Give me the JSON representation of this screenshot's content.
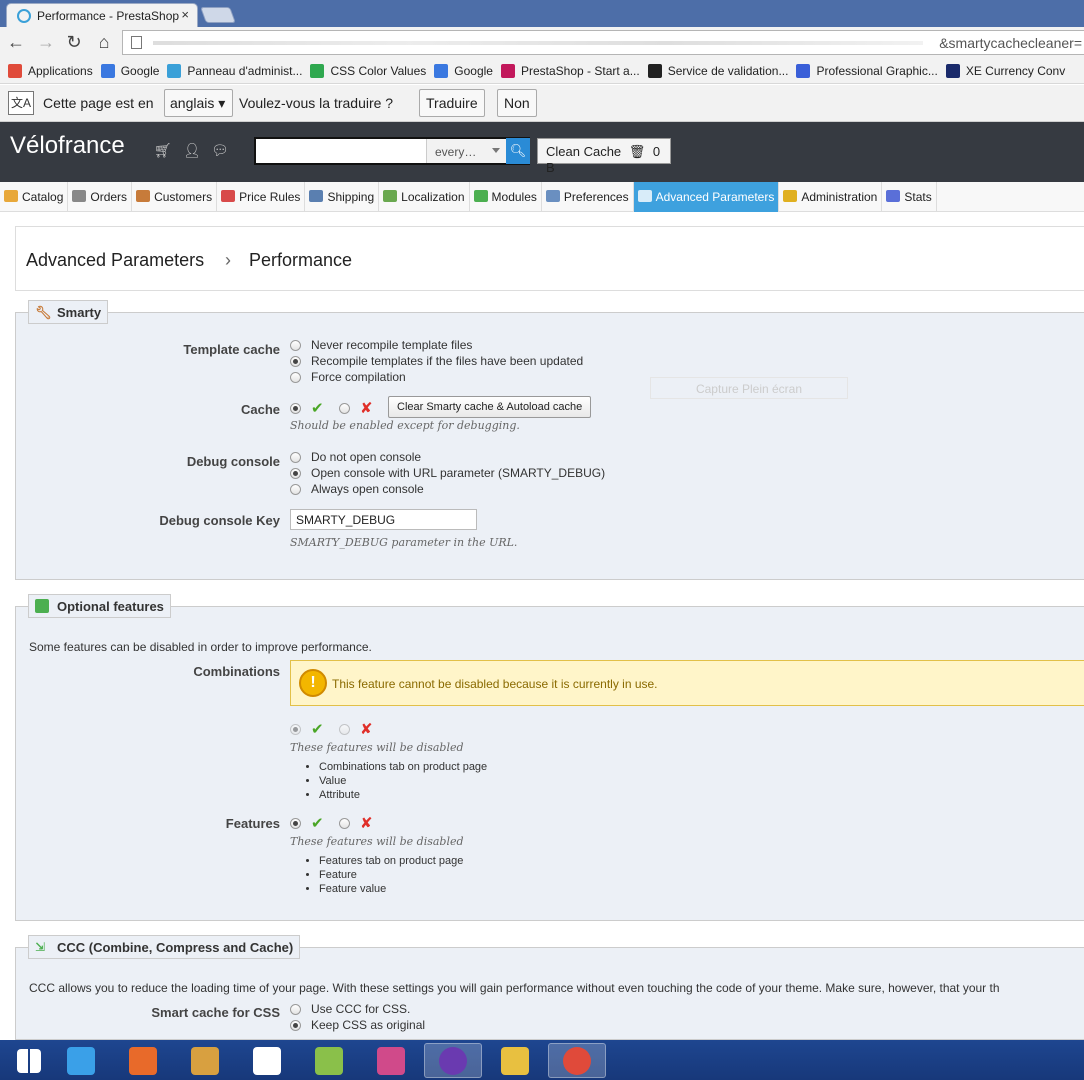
{
  "browser": {
    "tab_title": "Performance - PrestaShop",
    "tab_close": "×",
    "url_fragment": "&smartycachecleaner=",
    "bookmarks": [
      {
        "label": "Applications",
        "color": "#e04b3a"
      },
      {
        "label": "Google",
        "color": "#3a78e0"
      },
      {
        "label": "Panneau d'administ...",
        "color": "#3aa0d8"
      },
      {
        "label": "CSS Color Values",
        "color": "#2fa84f"
      },
      {
        "label": "Google",
        "color": "#3a78e0"
      },
      {
        "label": "PrestaShop - Start a...",
        "color": "#c2185b"
      },
      {
        "label": "Service de validation...",
        "color": "#222222"
      },
      {
        "label": "Professional Graphic...",
        "color": "#3a5fd8"
      },
      {
        "label": "XE Currency Conv",
        "color": "#1a2a6b"
      }
    ],
    "translate": {
      "prefix": "Cette page est en",
      "language": "anglais",
      "question": "Voulez-vous la traduire ?",
      "translate_btn": "Traduire",
      "no_btn": "Non"
    }
  },
  "header": {
    "shop_name": "Vélofrance",
    "search_placeholder": "",
    "search_scope": "every…",
    "clean_cache_label": "Clean Cache",
    "cache_size": "0 B"
  },
  "menu": [
    {
      "label": "Catalog",
      "color": "#e8a83a",
      "active": false
    },
    {
      "label": "Orders",
      "color": "#888888",
      "active": false
    },
    {
      "label": "Customers",
      "color": "#c77b3a",
      "active": false
    },
    {
      "label": "Price Rules",
      "color": "#d84a4a",
      "active": false
    },
    {
      "label": "Shipping",
      "color": "#5a7fb0",
      "active": false
    },
    {
      "label": "Localization",
      "color": "#6aa84f",
      "active": false
    },
    {
      "label": "Modules",
      "color": "#4caf50",
      "active": false
    },
    {
      "label": "Preferences",
      "color": "#6a8fc0",
      "active": false
    },
    {
      "label": "Advanced Parameters",
      "color": "#ffffff",
      "active": true
    },
    {
      "label": "Administration",
      "color": "#e0b020",
      "active": false
    },
    {
      "label": "Stats",
      "color": "#5a6fd8",
      "active": false
    }
  ],
  "breadcrumb": {
    "parent": "Advanced Parameters",
    "separator": "›",
    "current": "Performance"
  },
  "smarty": {
    "legend": "Smarty",
    "template_cache_label": "Template cache",
    "template_cache_options": [
      {
        "label": "Never recompile template files",
        "checked": false
      },
      {
        "label": "Recompile templates if the files have been updated",
        "checked": true
      },
      {
        "label": "Force compilation",
        "checked": false
      }
    ],
    "cache_label": "Cache",
    "clear_btn": "Clear Smarty cache & Autoload cache",
    "cache_hint": "Should be enabled except for debugging.",
    "debug_console_label": "Debug console",
    "debug_console_options": [
      {
        "label": "Do not open console",
        "checked": false
      },
      {
        "label": "Open console with URL parameter (SMARTY_DEBUG)",
        "checked": true
      },
      {
        "label": "Always open console",
        "checked": false
      }
    ],
    "debug_key_label": "Debug console Key",
    "debug_key_value": "SMARTY_DEBUG",
    "debug_key_hint": "SMARTY_DEBUG parameter in the URL."
  },
  "overlay_text": "Capture Plein écran",
  "optional": {
    "legend": "Optional features",
    "intro": "Some features can be disabled in order to improve performance.",
    "combinations_label": "Combinations",
    "warning": "This feature cannot be disabled because it is currently in use.",
    "combinations_hint": "These features will be disabled",
    "combinations_list": [
      "Combinations tab on product page",
      "Value",
      "Attribute"
    ],
    "features_label": "Features",
    "features_hint": "These features will be disabled",
    "features_list": [
      "Features tab on product page",
      "Feature",
      "Feature value"
    ]
  },
  "ccc": {
    "legend": "CCC (Combine, Compress and Cache)",
    "intro": "CCC allows you to reduce the loading time of your page. With these settings you will gain performance without even touching the code of your theme. Make sure, however, that your th",
    "css_label": "Smart cache for CSS",
    "css_options": [
      {
        "label": "Use CCC for CSS.",
        "checked": false
      },
      {
        "label": "Keep CSS as original",
        "checked": true
      }
    ]
  },
  "taskbar": [
    {
      "name": "start",
      "color": "#ffffff"
    },
    {
      "name": "internet-explorer",
      "color": "#3aa0e8"
    },
    {
      "name": "app-orange",
      "color": "#e86a2a"
    },
    {
      "name": "app-tools",
      "color": "#d8a040"
    },
    {
      "name": "amazon",
      "color": "#ffffff"
    },
    {
      "name": "notepad",
      "color": "#8ac04a"
    },
    {
      "name": "paint",
      "color": "#d04a8a"
    },
    {
      "name": "app-purple",
      "color": "#6a3ab0"
    },
    {
      "name": "explorer",
      "color": "#e8c040"
    },
    {
      "name": "chrome",
      "color": "#e04a3a"
    }
  ]
}
